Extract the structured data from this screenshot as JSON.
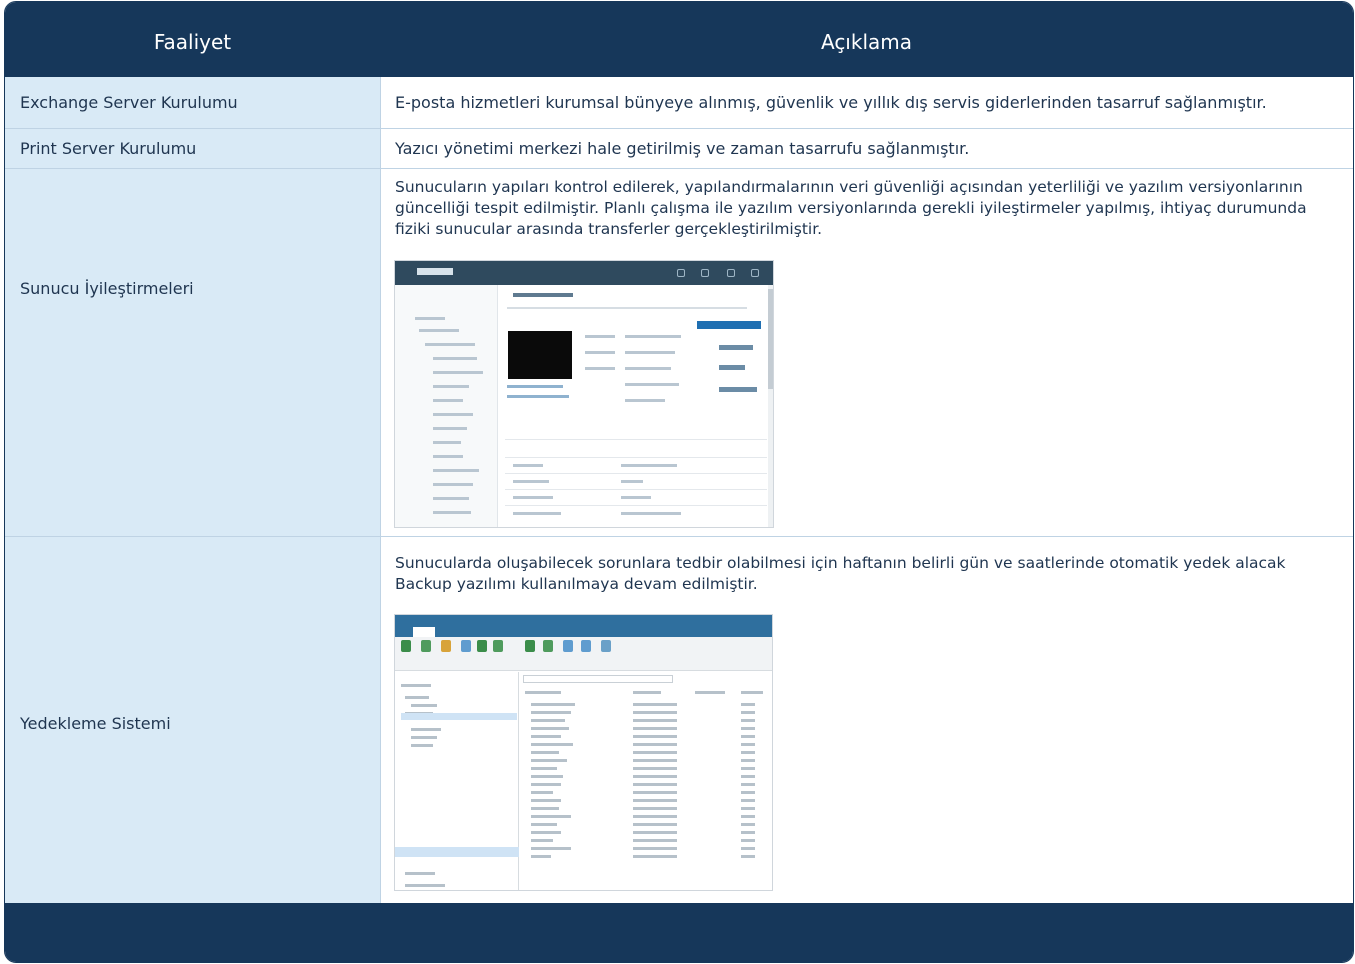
{
  "table": {
    "headers": {
      "activity": "Faaliyet",
      "description": "Açıklama"
    },
    "rows": [
      {
        "activity": "Exchange Server Kurulumu",
        "description": "E-posta hizmetleri kurumsal bünyeye alınmış, güvenlik ve yıllık dış servis giderlerinden tasarruf sağlanmıştır."
      },
      {
        "activity": "Print Server Kurulumu",
        "description": "Yazıcı yönetimi merkezi hale getirilmiş ve zaman tasarrufu sağlanmıştır."
      },
      {
        "activity": "Sunucu İyileştirmeleri",
        "description": "Sunucuların yapıları kontrol edilerek, yapılandırmalarının veri güvenliği açısından yeterliliği ve yazılım versiyonlarının güncelliği tespit edilmiştir. Planlı çalışma ile yazılım versiyonlarında gerekli iyileştirmeler yapılmış, ihtiyaç durumunda fiziki sunucular arasında transferler gerçekleştirilmiştir."
      },
      {
        "activity": "Yedekleme Sistemi",
        "description": "Sunucularda oluşabilecek sorunlara tedbir olabilmesi için haftanın belirli gün ve saatlerinde otomatik yedek alacak Backup yazılımı kullanılmaya devam edilmiştir."
      }
    ]
  },
  "colors": {
    "header_bg": "#16375a",
    "row_tint": "#d9eaf6",
    "text": "#1f3550"
  }
}
